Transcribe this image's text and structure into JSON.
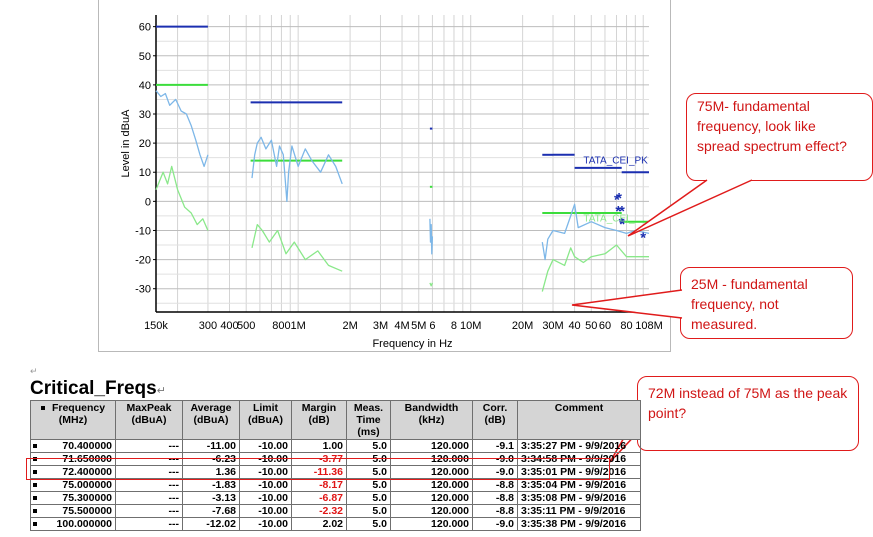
{
  "chart_data": {
    "type": "line",
    "xlabel": "Frequency in Hz",
    "ylabel": "Level in dBuA",
    "x_scale": "log",
    "xlim": [
      150000,
      108000000
    ],
    "ylim": [
      -38,
      64
    ],
    "y_ticks": [
      60,
      50,
      40,
      30,
      20,
      10,
      0,
      -10,
      -20,
      -30
    ],
    "x_ticks": [
      {
        "label": "150k",
        "value": 150000
      },
      {
        "label": "300",
        "value": 300000
      },
      {
        "label": "400",
        "value": 400000
      },
      {
        "label": "500",
        "value": 500000
      },
      {
        "label": "800",
        "value": 800000
      },
      {
        "label": "1M",
        "value": 1000000
      },
      {
        "label": "2M",
        "value": 2000000
      },
      {
        "label": "3M",
        "value": 3000000
      },
      {
        "label": "4M",
        "value": 4000000
      },
      {
        "label": "5M",
        "value": 5000000
      },
      {
        "label": "6",
        "value": 6000000
      },
      {
        "label": "8",
        "value": 8000000
      },
      {
        "label": "10M",
        "value": 10000000
      },
      {
        "label": "20M",
        "value": 20000000
      },
      {
        "label": "30M",
        "value": 30000000
      },
      {
        "label": "40",
        "value": 40000000
      },
      {
        "label": "50",
        "value": 50000000
      },
      {
        "label": "60",
        "value": 60000000
      },
      {
        "label": "80",
        "value": 80000000
      },
      {
        "label": "108M",
        "value": 108000000
      }
    ],
    "grid": true,
    "series": [
      {
        "name": "",
        "role": "limit-peak",
        "color": "#1b2fb0",
        "segments": [
          [
            [
              150000,
              60
            ],
            [
              300000,
              60
            ]
          ],
          [
            [
              530000,
              34
            ],
            [
              1800000,
              34
            ]
          ],
          [
            [
              5800000,
              25
            ],
            [
              6000000,
              25
            ]
          ],
          [
            [
              26000000,
              16
            ],
            [
              30000000,
              16
            ]
          ],
          [
            [
              30000000,
              16
            ],
            [
              40000000,
              16
            ]
          ],
          [
            [
              40000000,
              11.5
            ],
            [
              75000000,
              11.5
            ]
          ],
          [
            [
              75000000,
              10
            ],
            [
              108000000,
              10
            ]
          ]
        ]
      },
      {
        "name": "",
        "role": "limit-average",
        "color": "#3cdd3c",
        "segments": [
          [
            [
              150000,
              40
            ],
            [
              300000,
              40
            ]
          ],
          [
            [
              530000,
              14
            ],
            [
              1800000,
              14
            ]
          ],
          [
            [
              5800000,
              5
            ],
            [
              6000000,
              5
            ]
          ],
          [
            [
              26000000,
              -4
            ],
            [
              30000000,
              -4
            ]
          ],
          [
            [
              30000000,
              -4
            ],
            [
              75000000,
              -4
            ]
          ],
          [
            [
              75000000,
              -7
            ],
            [
              108000000,
              -7
            ]
          ]
        ]
      },
      {
        "name": "",
        "role": "peak-trace",
        "color": "#7db7e8",
        "segments": [
          [
            [
              150000,
              38
            ],
            [
              160000,
              36
            ],
            [
              170000,
              37
            ],
            [
              180000,
              33
            ],
            [
              195000,
              35
            ],
            [
              210000,
              31
            ],
            [
              225000,
              30
            ],
            [
              240000,
              26
            ],
            [
              255000,
              21
            ],
            [
              270000,
              16
            ],
            [
              285000,
              12
            ],
            [
              300000,
              16
            ]
          ],
          [
            [
              540000,
              8
            ],
            [
              560000,
              16
            ],
            [
              580000,
              20
            ],
            [
              610000,
              22
            ],
            [
              650000,
              18
            ],
            [
              700000,
              21
            ],
            [
              750000,
              12
            ],
            [
              780000,
              19
            ],
            [
              820000,
              16
            ],
            [
              860000,
              0
            ],
            [
              880000,
              10
            ],
            [
              920000,
              19
            ],
            [
              1000000,
              12
            ],
            [
              1100000,
              18
            ],
            [
              1200000,
              14
            ],
            [
              1350000,
              10
            ],
            [
              1500000,
              16
            ],
            [
              1650000,
              12
            ],
            [
              1800000,
              6
            ]
          ],
          [
            [
              5800000,
              -6
            ],
            [
              5850000,
              -14
            ],
            [
              5900000,
              -8
            ],
            [
              5950000,
              -18
            ],
            [
              6000000,
              -12
            ]
          ],
          [
            [
              26000000,
              -14
            ],
            [
              27000000,
              -20
            ],
            [
              28000000,
              -13
            ],
            [
              30000000,
              -10
            ],
            [
              35000000,
              -11
            ],
            [
              38000000,
              -5
            ],
            [
              40000000,
              -1
            ],
            [
              42000000,
              -9
            ],
            [
              50000000,
              -7
            ],
            [
              60000000,
              -9
            ],
            [
              70000000,
              -10
            ],
            [
              80000000,
              -11
            ],
            [
              90000000,
              -10
            ],
            [
              108000000,
              -11
            ]
          ]
        ]
      },
      {
        "name": "",
        "role": "average-trace",
        "color": "#8ae88a",
        "segments": [
          [
            [
              150000,
              4
            ],
            [
              165000,
              10
            ],
            [
              175000,
              6
            ],
            [
              185000,
              12
            ],
            [
              200000,
              4
            ],
            [
              220000,
              -2
            ],
            [
              240000,
              -4
            ],
            [
              260000,
              -8
            ],
            [
              280000,
              -6
            ],
            [
              300000,
              -10
            ]
          ],
          [
            [
              540000,
              -16
            ],
            [
              580000,
              -8
            ],
            [
              620000,
              -10
            ],
            [
              680000,
              -14
            ],
            [
              760000,
              -10
            ],
            [
              850000,
              -18
            ],
            [
              950000,
              -14
            ],
            [
              1100000,
              -20
            ],
            [
              1300000,
              -17
            ],
            [
              1500000,
              -22
            ],
            [
              1800000,
              -24
            ]
          ],
          [
            [
              5800000,
              -28
            ],
            [
              5900000,
              -29
            ],
            [
              6000000,
              -28
            ]
          ],
          [
            [
              26000000,
              -31
            ],
            [
              28000000,
              -24
            ],
            [
              30000000,
              -20
            ],
            [
              35000000,
              -22
            ],
            [
              38000000,
              -16
            ],
            [
              40000000,
              -19
            ],
            [
              45000000,
              -21
            ],
            [
              50000000,
              -19
            ],
            [
              60000000,
              -18
            ],
            [
              70000000,
              -15
            ],
            [
              80000000,
              -19
            ],
            [
              108000000,
              -19
            ]
          ]
        ]
      }
    ],
    "markers": {
      "symbol": "*",
      "color": "#1b2fb0",
      "points": [
        [
          70400000,
          1
        ],
        [
          71650000,
          -3
        ],
        [
          72400000,
          1.5
        ],
        [
          75000000,
          -7
        ],
        [
          75300000,
          -3
        ],
        [
          75500000,
          -7.5
        ],
        [
          100000000,
          -12
        ]
      ]
    },
    "annotations": [
      {
        "text": "TATA_CEI_PK",
        "x": 45000000,
        "y": 13,
        "color": "#1b2fb0"
      },
      {
        "text": "TATA_CEI_",
        "x": 45000000,
        "y": -7,
        "color": "#8ae88a"
      }
    ]
  },
  "callouts": {
    "c75": "75M- fundamental frequency, look like spread spectrum effect?",
    "c25": "25M - fundamental frequency, not measured.",
    "c72": "72M instead of 75M as the peak point?"
  },
  "section": {
    "title": "Critical_Freqs",
    "marks": {
      "para": "↵",
      "pil": "↵"
    }
  },
  "table": {
    "headers": [
      {
        "label1": "Frequency",
        "label2": "(MHz)"
      },
      {
        "label1": "MaxPeak",
        "label2": "(dBuA)"
      },
      {
        "label1": "Average",
        "label2": "(dBuA)"
      },
      {
        "label1": "Limit",
        "label2": "(dBuA)"
      },
      {
        "label1": "Margin",
        "label2": "(dB)"
      },
      {
        "label1": "Meas.",
        "label2": "Time",
        "label3": "(ms)"
      },
      {
        "label1": "Bandwidth",
        "label2": "(kHz)"
      },
      {
        "label1": "Corr.",
        "label2": "(dB)"
      },
      {
        "label1": "Comment",
        "label2": ""
      }
    ],
    "rows": [
      {
        "freq": "70.400000",
        "maxpeak": "---",
        "avg": "-11.00",
        "limit": "-10.00",
        "margin": "1.00",
        "margin_neg": false,
        "time": "5.0",
        "bw": "120.000",
        "corr": "-9.1",
        "comment": "3:35:27 PM - 9/9/2016"
      },
      {
        "freq": "71.650000",
        "maxpeak": "---",
        "avg": "-6.23",
        "limit": "-10.00",
        "margin": "-3.77",
        "margin_neg": true,
        "time": "5.0",
        "bw": "120.000",
        "corr": "-9.0",
        "comment": "3:34:58 PM - 9/9/2016"
      },
      {
        "freq": "72.400000",
        "maxpeak": "---",
        "avg": "1.36",
        "limit": "-10.00",
        "margin": "-11.36",
        "margin_neg": true,
        "time": "5.0",
        "bw": "120.000",
        "corr": "-9.0",
        "comment": "3:35:01 PM - 9/9/2016"
      },
      {
        "freq": "75.000000",
        "maxpeak": "---",
        "avg": "-1.83",
        "limit": "-10.00",
        "margin": "-8.17",
        "margin_neg": true,
        "time": "5.0",
        "bw": "120.000",
        "corr": "-8.8",
        "comment": "3:35:04 PM - 9/9/2016"
      },
      {
        "freq": "75.300000",
        "maxpeak": "---",
        "avg": "-3.13",
        "limit": "-10.00",
        "margin": "-6.87",
        "margin_neg": true,
        "time": "5.0",
        "bw": "120.000",
        "corr": "-8.8",
        "comment": "3:35:08 PM - 9/9/2016"
      },
      {
        "freq": "75.500000",
        "maxpeak": "---",
        "avg": "-7.68",
        "limit": "-10.00",
        "margin": "-2.32",
        "margin_neg": true,
        "time": "5.0",
        "bw": "120.000",
        "corr": "-8.8",
        "comment": "3:35:11 PM - 9/9/2016"
      },
      {
        "freq": "100.000000",
        "maxpeak": "---",
        "avg": "-12.02",
        "limit": "-10.00",
        "margin": "2.02",
        "margin_neg": false,
        "time": "5.0",
        "bw": "120.000",
        "corr": "-9.0",
        "comment": "3:35:38 PM - 9/9/2016"
      }
    ]
  },
  "colors": {
    "accent_red": "#e01b1b",
    "limit_blue": "#1b2fb0",
    "limit_green": "#3cdd3c"
  }
}
